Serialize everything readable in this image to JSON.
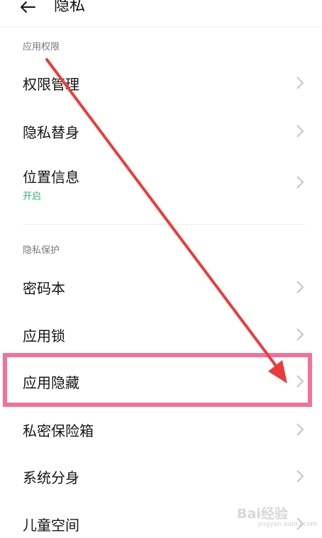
{
  "header": {
    "title": "隐私"
  },
  "sections": {
    "app_permissions": {
      "title": "应用权限",
      "items": [
        {
          "label": "权限管理",
          "sub": ""
        },
        {
          "label": "隐私替身",
          "sub": ""
        },
        {
          "label": "位置信息",
          "sub": "开启"
        }
      ]
    },
    "privacy_protection": {
      "title": "隐私保护",
      "items": [
        {
          "label": "密码本",
          "sub": ""
        },
        {
          "label": "应用锁",
          "sub": ""
        },
        {
          "label": "应用隐藏",
          "sub": ""
        },
        {
          "label": "私密保险箱",
          "sub": ""
        },
        {
          "label": "系统分身",
          "sub": ""
        },
        {
          "label": "儿童空间",
          "sub": ""
        }
      ]
    }
  },
  "colors": {
    "accent_green": "#2bb673",
    "highlight_pink": "#f27199",
    "arrow_red": "#ec3b3b"
  },
  "watermark": {
    "text": "Bai经验",
    "sub": "jingyan.baidu.com"
  }
}
